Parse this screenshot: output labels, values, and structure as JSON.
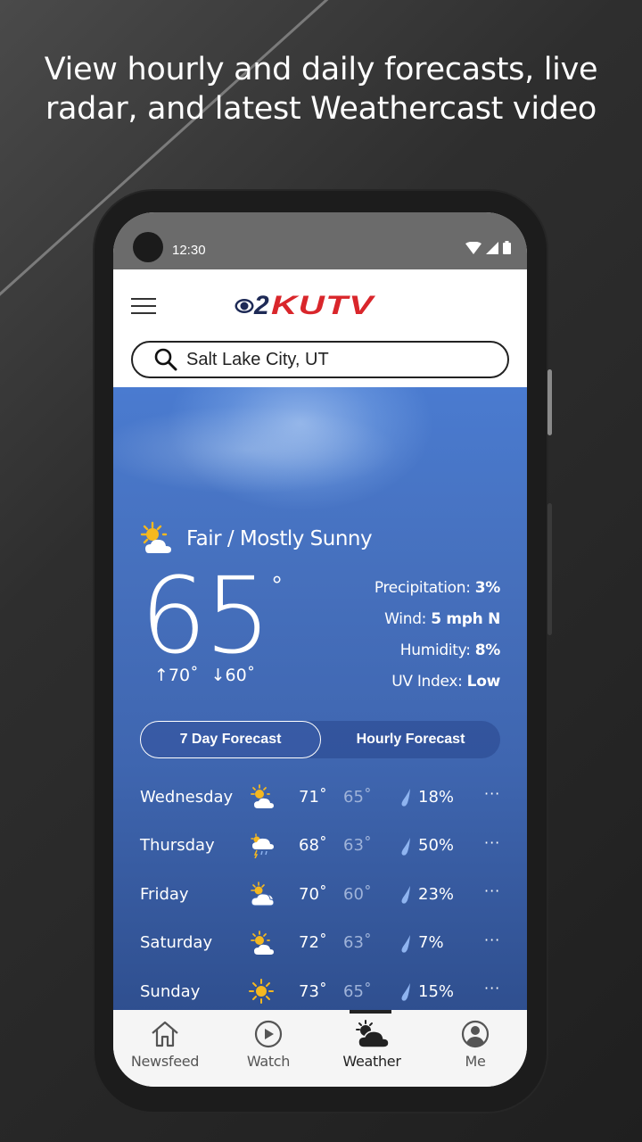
{
  "headline": {
    "line1": "View hourly and daily forecasts, live",
    "line2": "radar, and latest Weathercast video"
  },
  "status_bar": {
    "time": "12:30",
    "icons": [
      "wifi-icon",
      "signal-icon",
      "battery-icon"
    ]
  },
  "app_bar": {
    "menu_icon": "hamburger-icon",
    "logo_number": "2",
    "logo_text": "KUTV",
    "logo_colors": {
      "cbs": "#1e2a56",
      "kutv": "#d9262b"
    }
  },
  "search": {
    "value": "Salt Lake City, UT",
    "icon": "search-icon"
  },
  "current": {
    "condition": "Fair / Mostly Sunny",
    "condition_icon": "partly-sunny-icon",
    "temperature": "65",
    "degree": "°",
    "high": "↑70˚",
    "low": "↓60˚",
    "details": [
      {
        "label": "Precipitation: ",
        "value": "3%"
      },
      {
        "label": "Wind: ",
        "value": "5 mph N"
      },
      {
        "label": "Humidity: ",
        "value": "8%"
      },
      {
        "label": "UV Index: ",
        "value": "Low"
      }
    ]
  },
  "forecast_tabs": [
    {
      "label": "7 Day Forecast",
      "active": true
    },
    {
      "label": "Hourly Forecast",
      "active": false
    }
  ],
  "forecast": [
    {
      "day": "Wednesday",
      "icon": "partly-sunny-icon",
      "high": "71˚",
      "low": "65˚",
      "precip": "18%",
      "more": "···"
    },
    {
      "day": "Thursday",
      "icon": "thunderstorm-icon",
      "high": "68˚",
      "low": "63˚",
      "precip": "50%",
      "more": "···"
    },
    {
      "day": "Friday",
      "icon": "mostly-cloudy-icon",
      "high": "70˚",
      "low": "60˚",
      "precip": "23%",
      "more": "···"
    },
    {
      "day": "Saturday",
      "icon": "partly-sunny-icon",
      "high": "72˚",
      "low": "63˚",
      "precip": "7%",
      "more": "···"
    },
    {
      "day": "Sunday",
      "icon": "sunny-icon",
      "high": "73˚",
      "low": "65˚",
      "precip": "15%",
      "more": "···"
    }
  ],
  "bottom_nav": [
    {
      "label": "Newsfeed",
      "icon": "home-icon",
      "active": false
    },
    {
      "label": "Watch",
      "icon": "play-icon",
      "active": false
    },
    {
      "label": "Weather",
      "icon": "weather-icon",
      "active": true
    },
    {
      "label": "Me",
      "icon": "profile-icon",
      "active": false
    }
  ],
  "colors": {
    "sky_blue": "#4670bd",
    "sun_yellow": "#f5b820",
    "drop_blue": "#8fb4f0"
  }
}
